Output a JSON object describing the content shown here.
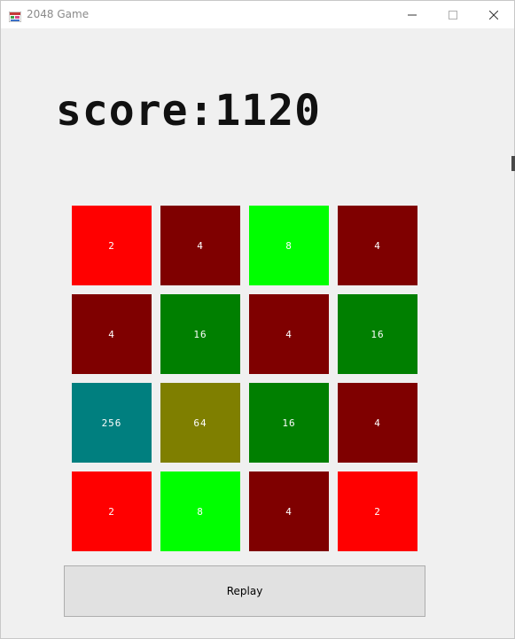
{
  "window": {
    "title": "2048 Game"
  },
  "score": {
    "text": "score:1120"
  },
  "board": {
    "tiles": [
      {
        "value": "2",
        "color": "#ff0000"
      },
      {
        "value": "4",
        "color": "#7f0000"
      },
      {
        "value": "8",
        "color": "#00ff00"
      },
      {
        "value": "4",
        "color": "#7f0000"
      },
      {
        "value": "4",
        "color": "#7f0000"
      },
      {
        "value": "16",
        "color": "#007f00"
      },
      {
        "value": "4",
        "color": "#7f0000"
      },
      {
        "value": "16",
        "color": "#007f00"
      },
      {
        "value": "256",
        "color": "#007f7f"
      },
      {
        "value": "64",
        "color": "#7f7f00"
      },
      {
        "value": "16",
        "color": "#007f00"
      },
      {
        "value": "4",
        "color": "#7f0000"
      },
      {
        "value": "2",
        "color": "#ff0000"
      },
      {
        "value": "8",
        "color": "#00ff00"
      },
      {
        "value": "4",
        "color": "#7f0000"
      },
      {
        "value": "2",
        "color": "#ff0000"
      }
    ]
  },
  "controls": {
    "replay_label": "Replay"
  }
}
